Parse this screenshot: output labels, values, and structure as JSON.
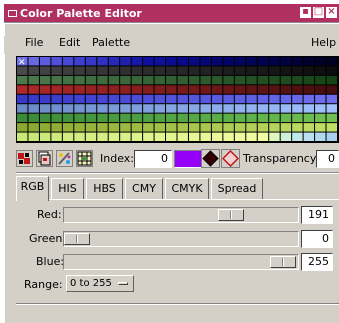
{
  "window": {
    "title": "Color Palette Editor",
    "title_bg": "#b03060"
  },
  "menu": {
    "file": "File",
    "edit": "Edit",
    "palette": "Palette",
    "help": "Help"
  },
  "palette_rows": [
    [
      "#7070e8",
      "#6868e0",
      "#5c5ce0",
      "#5050d8",
      "#4848d8",
      "#4040d0",
      "#3838c8",
      "#3030c0",
      "#2828b8",
      "#2020b0",
      "#1818a8",
      "#1010a0",
      "#101098",
      "#0c0c90",
      "#080888",
      "#080880",
      "#060678",
      "#050570",
      "#040468",
      "#030360",
      "#030358",
      "#020250",
      "#020248",
      "#020240",
      "#010138",
      "#010130",
      "#010128",
      "#000020"
    ],
    [
      "#4a4a4a",
      "#454545",
      "#424242",
      "#404040",
      "#3d3d3d",
      "#3a3a3a",
      "#373737",
      "#353535",
      "#333333",
      "#303030",
      "#2e2e2e",
      "#2c2c2c",
      "#2a2a2a",
      "#282828",
      "#262626",
      "#242424",
      "#222222",
      "#202020",
      "#1e1e1e",
      "#1c1c1c",
      "#1a1a1a",
      "#181818",
      "#161616",
      "#141414",
      "#121212",
      "#101010",
      "#0e0e0e",
      "#0c0c0c"
    ],
    [
      "#4c7a4c",
      "#4a784a",
      "#487648",
      "#467446",
      "#447244",
      "#427042",
      "#406e40",
      "#3e6c3e",
      "#3c6a3c",
      "#3a683a",
      "#386638",
      "#366436",
      "#346234",
      "#326032",
      "#305e30",
      "#2e5c2e",
      "#2c5a2c",
      "#2a582a",
      "#285628",
      "#265426",
      "#245224",
      "#225022",
      "#204e20",
      "#1e4c1e",
      "#1c4a1c",
      "#1a481a",
      "#184618",
      "#164416"
    ],
    [
      "#b02828",
      "#ac2828",
      "#a82626",
      "#a42626",
      "#a02424",
      "#9c2424",
      "#982222",
      "#942222",
      "#902020",
      "#8c2020",
      "#881e1e",
      "#841e1e",
      "#801c1c",
      "#7c1c1c",
      "#781a1a",
      "#741a1a",
      "#701818",
      "#6c1818",
      "#681616",
      "#641616",
      "#601414",
      "#5c1414",
      "#581212",
      "#541212",
      "#501010",
      "#4c1010",
      "#480e0e",
      "#440e0e"
    ],
    [
      "#3838c8",
      "#3a3ac8",
      "#3c3cca",
      "#3e3ecc",
      "#4040ce",
      "#4242d0",
      "#4444d0",
      "#4646d2",
      "#4848d4",
      "#4a4ad4",
      "#4c4cd6",
      "#4e4ed8",
      "#5050d8",
      "#5252da",
      "#5454dc",
      "#5656dc",
      "#5858de",
      "#5a5ae0",
      "#5c5ce0",
      "#5e5ee2",
      "#6060e4",
      "#6262e4",
      "#6464e6",
      "#6666e8",
      "#6868e8",
      "#6a6aea",
      "#6c6cec",
      "#6e6eec"
    ],
    [
      "#6a8ac8",
      "#6c8cca",
      "#6e8ecc",
      "#7090ce",
      "#7292d0",
      "#7494d2",
      "#7696d4",
      "#7898d6",
      "#7a9ad8",
      "#7c9cda",
      "#7e9edc",
      "#80a0de",
      "#82a2e0",
      "#84a4e2",
      "#86a6e4",
      "#88a8e6",
      "#8aaae8",
      "#8cacea",
      "#8eaeec",
      "#90b0ee",
      "#92b2f0",
      "#94b4f2",
      "#96b6f4",
      "#98b8f6",
      "#9abaf8",
      "#9cbcfa",
      "#9ebefc",
      "#a0c0fe"
    ],
    [
      "#3a8a3a",
      "#3c8c3a",
      "#3e8e3a",
      "#40903c",
      "#42923c",
      "#44943e",
      "#46963e",
      "#489840",
      "#4a9a40",
      "#4c9c42",
      "#4e9e42",
      "#50a044",
      "#52a244",
      "#54a446",
      "#56a646",
      "#58a848",
      "#5aaa48",
      "#5cac4a",
      "#5eae4a",
      "#60b04c",
      "#62b24c",
      "#64b44e",
      "#66b64e",
      "#68b850",
      "#6aba50",
      "#6cbc52",
      "#6ebe52",
      "#70c054"
    ],
    [
      "#8aa830",
      "#8caa32",
      "#8eac34",
      "#90ae36",
      "#92b038",
      "#94b23a",
      "#96b43c",
      "#98b63e",
      "#9ab840",
      "#9cba42",
      "#9ebc44",
      "#a0be46",
      "#a2c048",
      "#a4c24a",
      "#a6c44c",
      "#a8c64e",
      "#aac850",
      "#acca52",
      "#aecc54",
      "#b0ce56",
      "#b2d058",
      "#b4d25a",
      "#b6d45c",
      "#b8d65e",
      "#bad860",
      "#bcda62",
      "#bedc64",
      "#c0de66"
    ],
    [
      "#c8e878",
      "#cae87a",
      "#ccea7c",
      "#ceea7e",
      "#d0ec80",
      "#d2ec82",
      "#d4ee84",
      "#d6ee86",
      "#d8f088",
      "#daf08a",
      "#dcf28c",
      "#def28e",
      "#e0f490",
      "#e2f492",
      "#e4f694",
      "#e6f696",
      "#e8f898",
      "#eaf89a",
      "#ecfa9c",
      "#eefa9e",
      "#f0fca0",
      "#f2fca2",
      "#e0f8c0",
      "#d0f0d8",
      "#c0e8e8",
      "#b8e0f0",
      "#b0d8f0",
      "#a8d0f0"
    ]
  ],
  "palette_selected_glyph": "✕",
  "toolbar": {
    "index_label": "Index:",
    "index_value": "0",
    "index_color": "#9400f8",
    "transparency_label": "Transparency:",
    "transparency_value": "0"
  },
  "tabs": [
    "RGB",
    "HIS",
    "HBS",
    "CMY",
    "CMYK",
    "Spread"
  ],
  "active_tab": "RGB",
  "sliders": {
    "red": {
      "label": "Red:",
      "value": "191",
      "fraction": 0.749
    },
    "green": {
      "label": "Green:",
      "value": "0",
      "fraction": 0.0
    },
    "blue": {
      "label": "Blue:",
      "value": "255",
      "fraction": 1.0
    }
  },
  "range": {
    "label": "Range:",
    "value": "0 to 255"
  },
  "icons": [
    "palette-red-icon",
    "copy-icon",
    "color-wand-icon",
    "grid-icon",
    "diamond-filled-icon",
    "diamond-outline-icon"
  ]
}
